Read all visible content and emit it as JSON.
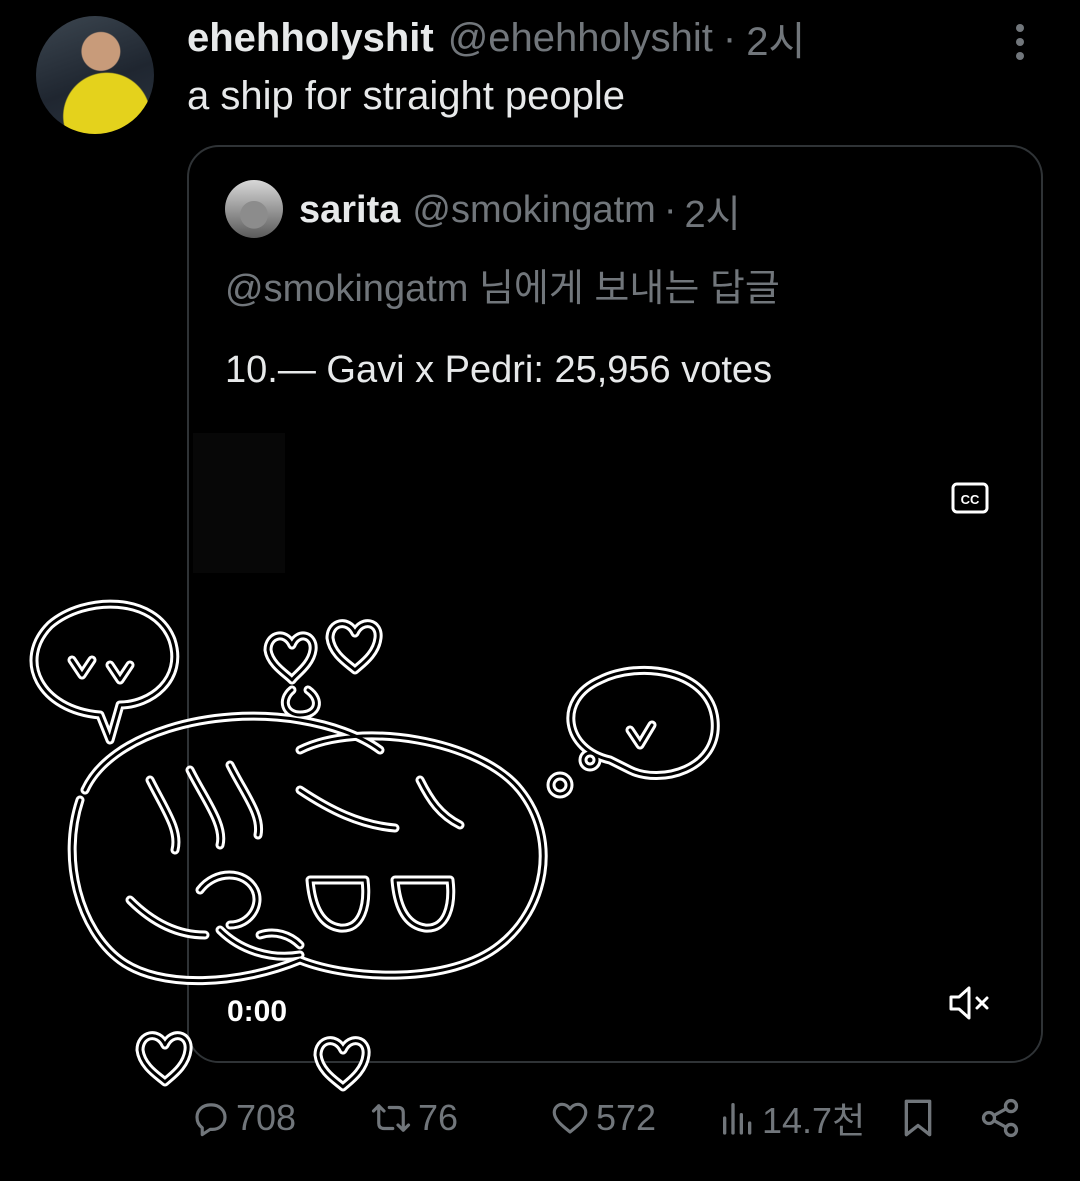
{
  "tweet": {
    "display_name": "ehehholyshit",
    "handle": "@ehehholyshit",
    "separator": "·",
    "time": "2시",
    "text": "a ship for straight people"
  },
  "quoted_tweet": {
    "display_name": "sarita",
    "handle": "@smokingatm",
    "separator": "·",
    "time": "2시",
    "replying_to": "@smokingatm 님에게 보내는 답글",
    "text": "10.— Gavi x Pedri: 25,956 votes",
    "video": {
      "timestamp": "0:00",
      "captions_icon": "cc-icon",
      "mute_icon": "mute-icon"
    }
  },
  "actions": {
    "replies": "708",
    "retweets": "76",
    "likes": "572",
    "views": "14.7천"
  },
  "colors": {
    "background": "#000000",
    "text_primary": "#e7e9ea",
    "text_secondary": "#71767b",
    "border": "#2f3336"
  }
}
